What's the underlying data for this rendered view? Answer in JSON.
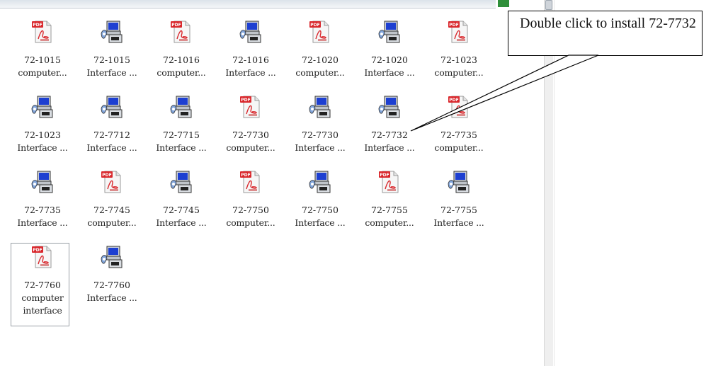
{
  "window": {
    "title": ""
  },
  "items": [
    {
      "name": "72-1015",
      "desc": "computer...",
      "icon": "pdf-icon"
    },
    {
      "name": "72-1015",
      "desc": "Interface ...",
      "icon": "installer-icon"
    },
    {
      "name": "72-1016",
      "desc": "computer...",
      "icon": "pdf-icon"
    },
    {
      "name": "72-1016",
      "desc": "Interface ...",
      "icon": "installer-icon"
    },
    {
      "name": "72-1020",
      "desc": "computer...",
      "icon": "pdf-icon"
    },
    {
      "name": "72-1020",
      "desc": "Interface ...",
      "icon": "installer-icon"
    },
    {
      "name": "72-1023",
      "desc": "computer...",
      "icon": "pdf-icon"
    },
    {
      "name": "72-1023",
      "desc": "Interface ...",
      "icon": "installer-icon"
    },
    {
      "name": "72-7712",
      "desc": "Interface ...",
      "icon": "installer-icon"
    },
    {
      "name": "72-7715",
      "desc": "Interface ...",
      "icon": "installer-icon"
    },
    {
      "name": "72-7730",
      "desc": "computer...",
      "icon": "pdf-icon"
    },
    {
      "name": "72-7730",
      "desc": "Interface ...",
      "icon": "installer-icon"
    },
    {
      "name": "72-7732",
      "desc": "Interface ...",
      "icon": "installer-icon"
    },
    {
      "name": "72-7735",
      "desc": "computer...",
      "icon": "pdf-icon"
    },
    {
      "name": "72-7735",
      "desc": "Interface ...",
      "icon": "installer-icon"
    },
    {
      "name": "72-7745",
      "desc": "computer...",
      "icon": "pdf-icon"
    },
    {
      "name": "72-7745",
      "desc": "Interface ...",
      "icon": "installer-icon"
    },
    {
      "name": "72-7750",
      "desc": "computer...",
      "icon": "pdf-icon"
    },
    {
      "name": "72-7750",
      "desc": "Interface ...",
      "icon": "installer-icon"
    },
    {
      "name": "72-7755",
      "desc": "computer...",
      "icon": "pdf-icon"
    },
    {
      "name": "72-7755",
      "desc": "Interface ...",
      "icon": "installer-icon"
    },
    {
      "name": "72-7760",
      "desc": "computer interface",
      "icon": "pdf-icon",
      "selected": true
    },
    {
      "name": "72-7760",
      "desc": "Interface ...",
      "icon": "installer-icon"
    }
  ],
  "callout": {
    "text": "Double click to install 72-7732"
  },
  "colors": {
    "pdf_red": "#d9262b",
    "installer_blue": "#1d3fd1"
  }
}
